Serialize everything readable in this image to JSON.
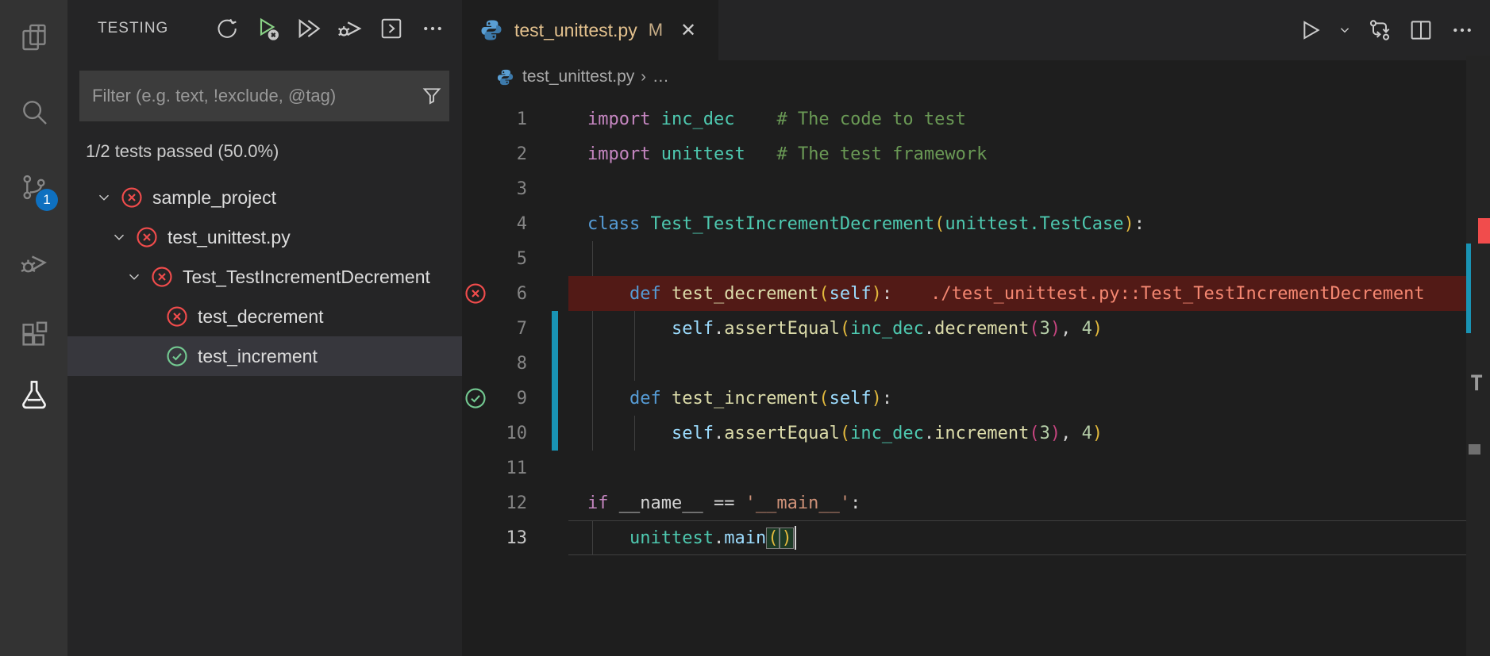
{
  "activity_bar": {
    "items": [
      "explorer-icon",
      "search-icon",
      "source-control-icon",
      "run-and-debug-icon",
      "extensions-icon",
      "testing-icon"
    ],
    "active_item": "testing-icon",
    "scm_badge": "1"
  },
  "sidebar": {
    "title": "TESTING",
    "toolbar_icons": [
      "refresh-tests-icon",
      "run-failed-tests-icon",
      "run-all-tests-icon",
      "debug-tests-icon",
      "open-panel-icon",
      "more-actions-icon"
    ],
    "filter_placeholder": "Filter (e.g. text, !exclude, @tag)",
    "summary": "1/2 tests passed (50.0%)",
    "tree": [
      {
        "label": "sample_project",
        "state": "fail",
        "indent": 0,
        "expandable": true,
        "selected": false
      },
      {
        "label": "test_unittest.py",
        "state": "fail",
        "indent": 1,
        "expandable": true,
        "selected": false
      },
      {
        "label": "Test_TestIncrementDecrement",
        "state": "fail",
        "indent": 2,
        "expandable": true,
        "selected": false
      },
      {
        "label": "test_decrement",
        "state": "fail",
        "indent": 3,
        "expandable": false,
        "selected": false
      },
      {
        "label": "test_increment",
        "state": "pass",
        "indent": 3,
        "expandable": false,
        "selected": true
      }
    ]
  },
  "editor": {
    "tab": {
      "label": "test_unittest.py",
      "modified": "M",
      "close": "✕",
      "language_icon": "python-icon"
    },
    "actions": [
      "run-python-file-icon",
      "run-dropdown-chevron-icon",
      "open-changes-icon",
      "split-editor-icon",
      "more-actions-icon"
    ],
    "breadcrumb": {
      "file": "test_unittest.py",
      "separator": "›",
      "more": "…"
    },
    "code": {
      "lines": [
        {
          "n": "1",
          "git": false,
          "tokens": [
            [
              "kw",
              "import"
            ],
            [
              "pln",
              " "
            ],
            [
              "typ",
              "inc_dec"
            ],
            [
              "pln",
              "    "
            ],
            [
              "cmt",
              "# The code to test"
            ]
          ]
        },
        {
          "n": "2",
          "git": false,
          "tokens": [
            [
              "kw",
              "import"
            ],
            [
              "pln",
              " "
            ],
            [
              "typ",
              "unittest"
            ],
            [
              "pln",
              "   "
            ],
            [
              "cmt",
              "# The test framework"
            ]
          ]
        },
        {
          "n": "3",
          "git": false,
          "tokens": []
        },
        {
          "n": "4",
          "git": false,
          "tokens": [
            [
              "kw2",
              "class"
            ],
            [
              "pln",
              " "
            ],
            [
              "typ",
              "Test_TestIncrementDecrement"
            ],
            [
              "b1",
              "("
            ],
            [
              "typ",
              "unittest.TestCase"
            ],
            [
              "b1",
              ")"
            ],
            [
              "pln",
              ":"
            ]
          ]
        },
        {
          "n": "5",
          "git": false,
          "tokens": []
        },
        {
          "n": "6",
          "git": false,
          "test": "fail",
          "bg": "error",
          "err": "./test_unittest.py::Test_TestIncrementDecrement",
          "tokens": [
            [
              "pln",
              "    "
            ],
            [
              "kw2",
              "def"
            ],
            [
              "pln",
              " "
            ],
            [
              "fn",
              "test_decrement"
            ],
            [
              "b1",
              "("
            ],
            [
              "var",
              "self"
            ],
            [
              "b1",
              ")"
            ],
            [
              "pln",
              ":"
            ]
          ]
        },
        {
          "n": "7",
          "git": true,
          "tokens": [
            [
              "pln",
              "        "
            ],
            [
              "var",
              "self"
            ],
            [
              "pln",
              "."
            ],
            [
              "fn",
              "assertEqual"
            ],
            [
              "b1",
              "("
            ],
            [
              "typ",
              "inc_dec"
            ],
            [
              "pln",
              "."
            ],
            [
              "fn",
              "decrement"
            ],
            [
              "b2",
              "("
            ],
            [
              "num",
              "3"
            ],
            [
              "b2",
              ")"
            ],
            [
              "pln",
              ", "
            ],
            [
              "num",
              "4"
            ],
            [
              "b1",
              ")"
            ]
          ]
        },
        {
          "n": "8",
          "git": true,
          "tokens": []
        },
        {
          "n": "9",
          "git": true,
          "test": "pass",
          "tokens": [
            [
              "pln",
              "    "
            ],
            [
              "kw2",
              "def"
            ],
            [
              "pln",
              " "
            ],
            [
              "fn",
              "test_increment"
            ],
            [
              "b1",
              "("
            ],
            [
              "var",
              "self"
            ],
            [
              "b1",
              ")"
            ],
            [
              "pln",
              ":"
            ]
          ]
        },
        {
          "n": "10",
          "git": true,
          "tokens": [
            [
              "pln",
              "        "
            ],
            [
              "var",
              "self"
            ],
            [
              "pln",
              "."
            ],
            [
              "fn",
              "assertEqual"
            ],
            [
              "b1",
              "("
            ],
            [
              "typ",
              "inc_dec"
            ],
            [
              "pln",
              "."
            ],
            [
              "fn",
              "increment"
            ],
            [
              "b2",
              "("
            ],
            [
              "num",
              "3"
            ],
            [
              "b2",
              ")"
            ],
            [
              "pln",
              ", "
            ],
            [
              "num",
              "4"
            ],
            [
              "b1",
              ")"
            ]
          ]
        },
        {
          "n": "11",
          "git": false,
          "tokens": []
        },
        {
          "n": "12",
          "git": false,
          "tokens": [
            [
              "kw",
              "if"
            ],
            [
              "pln",
              " __name__ == "
            ],
            [
              "str",
              "'__main__'"
            ],
            [
              "pln",
              ":"
            ]
          ]
        },
        {
          "n": "13",
          "git": false,
          "current": true,
          "cursor": true,
          "tokens": [
            [
              "pln",
              "    "
            ],
            [
              "typ",
              "unittest"
            ],
            [
              "pln",
              "."
            ],
            [
              "var",
              "main"
            ],
            [
              "bm",
              "("
            ],
            [
              "bm",
              ")"
            ]
          ]
        }
      ]
    }
  },
  "colors": {
    "test_pass": "#73c991",
    "test_fail": "#f14c4c",
    "modified_tab_label": "#e2c08d",
    "git_modified_gutter": "#1993b4",
    "scm_badge_bg": "#0e70c0",
    "error_line_bg": "#521a16",
    "error_message": "#f48771",
    "sidebar_bg": "#252526",
    "editor_bg": "#1e1e1e",
    "activity_bar_bg": "#333333",
    "selected_row_bg": "#37373d"
  }
}
